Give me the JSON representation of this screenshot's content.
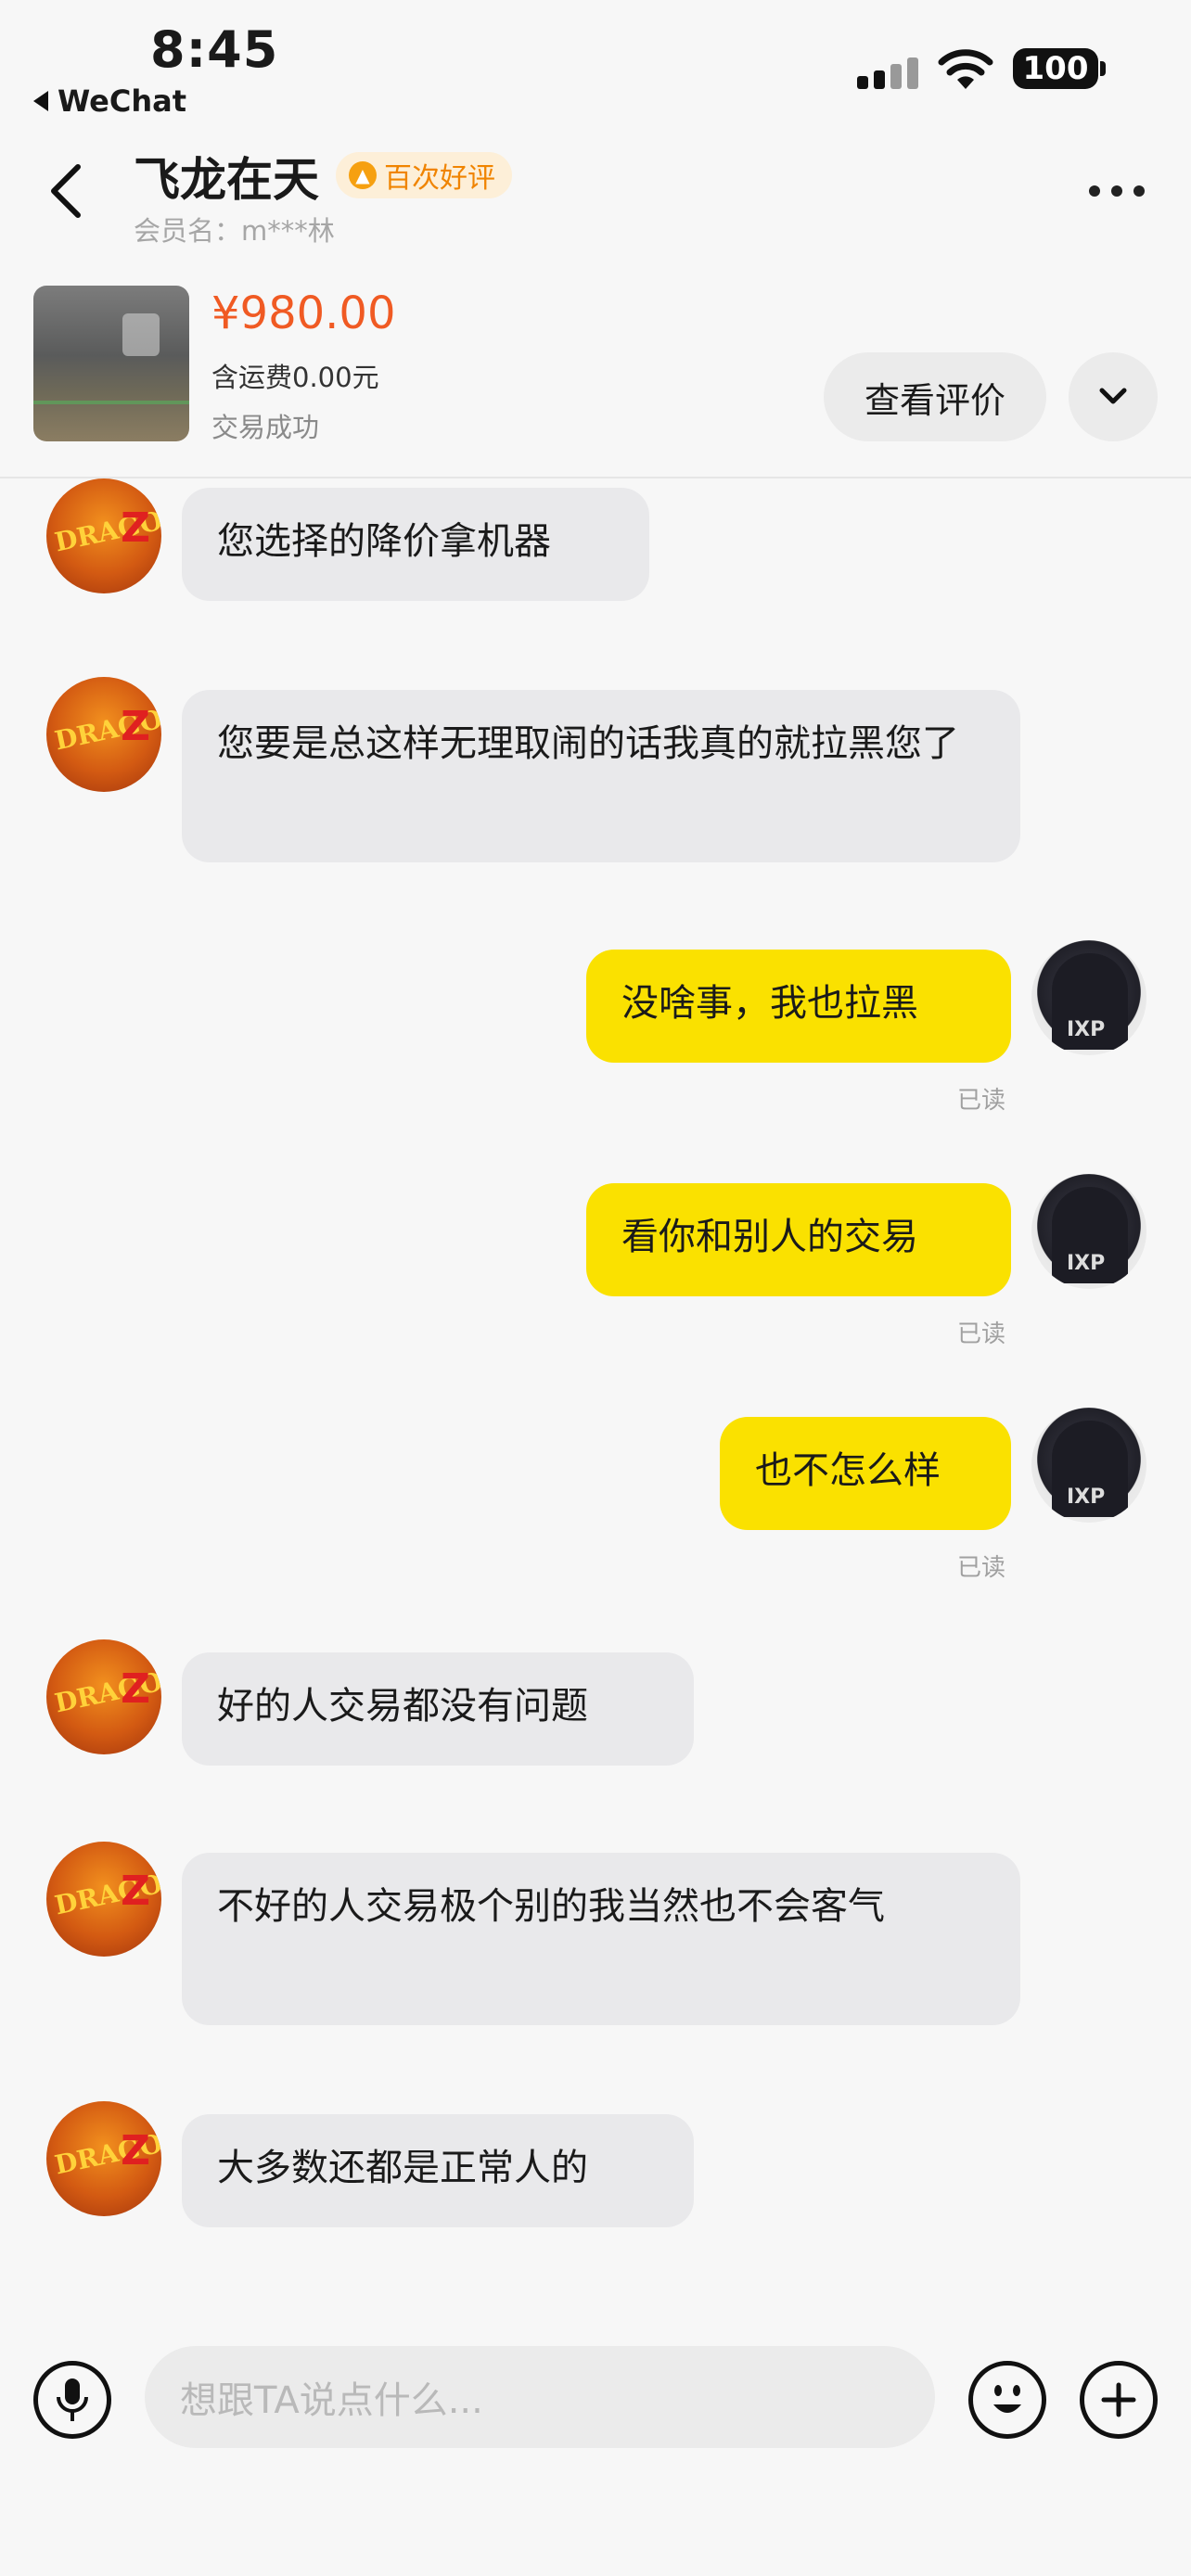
{
  "status_bar": {
    "time": "8:45",
    "back_app": "WeChat",
    "battery": "100"
  },
  "header": {
    "nickname": "飞龙在天",
    "badge": "百次好评",
    "member": "会员名：m***林"
  },
  "product": {
    "price": "¥980.00",
    "shipping": "含运费0.00元",
    "status": "交易成功",
    "review_button": "查看评价"
  },
  "messages": [
    {
      "from": "other",
      "text": "您选择的降价拿机器"
    },
    {
      "from": "other",
      "text": "您要是总这样无理取闹的话我真的就拉黑您了"
    },
    {
      "from": "self",
      "text": "没啥事，我也拉黑",
      "read": "已读"
    },
    {
      "from": "self",
      "text": "看你和别人的交易",
      "read": "已读"
    },
    {
      "from": "self",
      "text": "也不怎么样",
      "read": "已读"
    },
    {
      "from": "other",
      "text": "好的人交易都没有问题"
    },
    {
      "from": "other",
      "text": "不好的人交易极个别的我当然也不会客气"
    },
    {
      "from": "other",
      "text": "大多数还都是正常人的"
    }
  ],
  "input": {
    "placeholder": "想跟TA说点什么..."
  },
  "colors": {
    "price": "#f05a23",
    "self_bubble": "#fae100",
    "other_bubble": "#e9e9eb",
    "badge": "#f08400"
  }
}
